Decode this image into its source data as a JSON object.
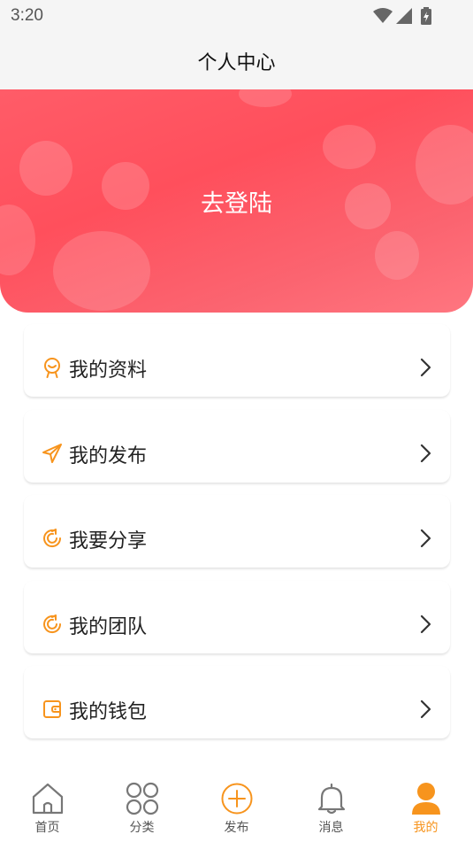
{
  "status_bar": {
    "time": "3:20",
    "icons": [
      "wifi-icon",
      "signal-icon",
      "battery-charging-icon"
    ]
  },
  "header": {
    "title": "个人中心"
  },
  "banner": {
    "login_label": "去登陆"
  },
  "menu": {
    "items": [
      {
        "label": "我的资料",
        "icon": "profile-badge-icon"
      },
      {
        "label": "我的发布",
        "icon": "paper-plane-icon"
      },
      {
        "label": "我要分享",
        "icon": "share-refresh-icon"
      },
      {
        "label": "我的团队",
        "icon": "team-refresh-icon"
      },
      {
        "label": "我的钱包",
        "icon": "wallet-icon"
      }
    ]
  },
  "tab_bar": {
    "tabs": [
      {
        "label": "首页",
        "icon": "home-icon",
        "active": false
      },
      {
        "label": "分类",
        "icon": "category-icon",
        "active": false
      },
      {
        "label": "发布",
        "icon": "publish-plus-icon",
        "active": false
      },
      {
        "label": "消息",
        "icon": "bell-icon",
        "active": false
      },
      {
        "label": "我的",
        "icon": "user-icon",
        "active": true
      }
    ]
  },
  "colors": {
    "accent": "#f7941d",
    "banner": "#ff5c68",
    "title_bar": "#f5f5f5"
  }
}
